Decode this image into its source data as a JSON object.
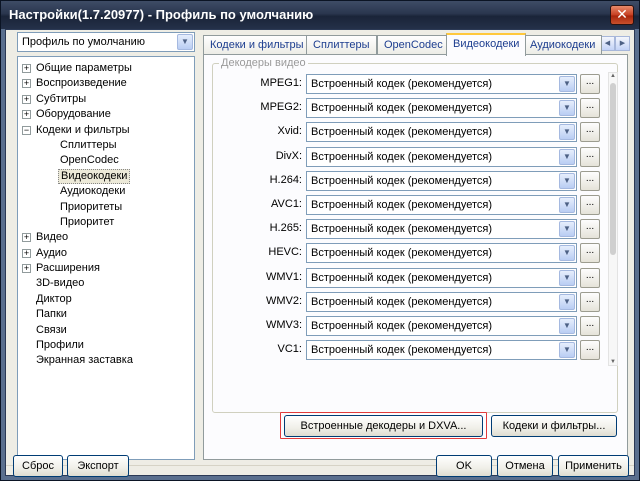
{
  "window": {
    "title": "Настройки(1.7.20977) - Профиль по умолчанию",
    "close_glyph": "✕"
  },
  "profile_select": {
    "value": "Профиль по умолчанию"
  },
  "tree": [
    {
      "label": "Общие параметры",
      "expander": "+",
      "level": 0
    },
    {
      "label": "Воспроизведение",
      "expander": "+",
      "level": 0
    },
    {
      "label": "Субтитры",
      "expander": "+",
      "level": 0
    },
    {
      "label": "Оборудование",
      "expander": "+",
      "level": 0
    },
    {
      "label": "Кодеки и фильтры",
      "expander": "−",
      "level": 0
    },
    {
      "label": "Сплиттеры",
      "expander": "",
      "level": 1
    },
    {
      "label": "OpenCodec",
      "expander": "",
      "level": 1
    },
    {
      "label": "Видеокодеки",
      "expander": "",
      "level": 1,
      "selected": true
    },
    {
      "label": "Аудиокодеки",
      "expander": "",
      "level": 1
    },
    {
      "label": "Приоритеты",
      "expander": "",
      "level": 1
    },
    {
      "label": "Приоритет",
      "expander": "",
      "level": 1
    },
    {
      "label": "Видео",
      "expander": "+",
      "level": 0
    },
    {
      "label": "Аудио",
      "expander": "+",
      "level": 0
    },
    {
      "label": "Расширения",
      "expander": "+",
      "level": 0
    },
    {
      "label": "3D-видео",
      "expander": "",
      "level": 0
    },
    {
      "label": "Диктор",
      "expander": "",
      "level": 0
    },
    {
      "label": "Папки",
      "expander": "",
      "level": 0
    },
    {
      "label": "Связи",
      "expander": "",
      "level": 0
    },
    {
      "label": "Профили",
      "expander": "",
      "level": 0
    },
    {
      "label": "Экранная заставка",
      "expander": "",
      "level": 0
    }
  ],
  "tabs": [
    {
      "label": "Кодеки и фильтры"
    },
    {
      "label": "Сплиттеры"
    },
    {
      "label": "OpenCodec"
    },
    {
      "label": "Видеокодеки",
      "active": true
    },
    {
      "label": "Аудиокодеки"
    }
  ],
  "group": {
    "label": "Декодеры видео",
    "rows": [
      {
        "label": "MPEG1:",
        "value": "Встроенный кодек (рекомендуется)"
      },
      {
        "label": "MPEG2:",
        "value": "Встроенный кодек (рекомендуется)"
      },
      {
        "label": "Xvid:",
        "value": "Встроенный кодек (рекомендуется)"
      },
      {
        "label": "DivX:",
        "value": "Встроенный кодек (рекомендуется)"
      },
      {
        "label": "H.264:",
        "value": "Встроенный кодек (рекомендуется)"
      },
      {
        "label": "AVC1:",
        "value": "Встроенный кодек (рекомендуется)"
      },
      {
        "label": "H.265:",
        "value": "Встроенный кодек (рекомендуется)"
      },
      {
        "label": "HEVC:",
        "value": "Встроенный кодек (рекомендуется)"
      },
      {
        "label": "WMV1:",
        "value": "Встроенный кодек (рекомендуется)"
      },
      {
        "label": "WMV2:",
        "value": "Встроенный кодек (рекомендуется)"
      },
      {
        "label": "WMV3:",
        "value": "Встроенный кодек (рекомендуется)"
      },
      {
        "label": "VC1:",
        "value": "Встроенный кодек (рекомендуется)"
      }
    ],
    "more_label": "..."
  },
  "panel_buttons": {
    "builtin_dxva": "Встроенные декодеры и DXVA...",
    "codecs_filters": "Кодеки и фильтры..."
  },
  "footer": {
    "reset": "Сброс",
    "export": "Экспорт",
    "ok": "OK",
    "cancel": "Отмена",
    "apply": "Применить"
  }
}
